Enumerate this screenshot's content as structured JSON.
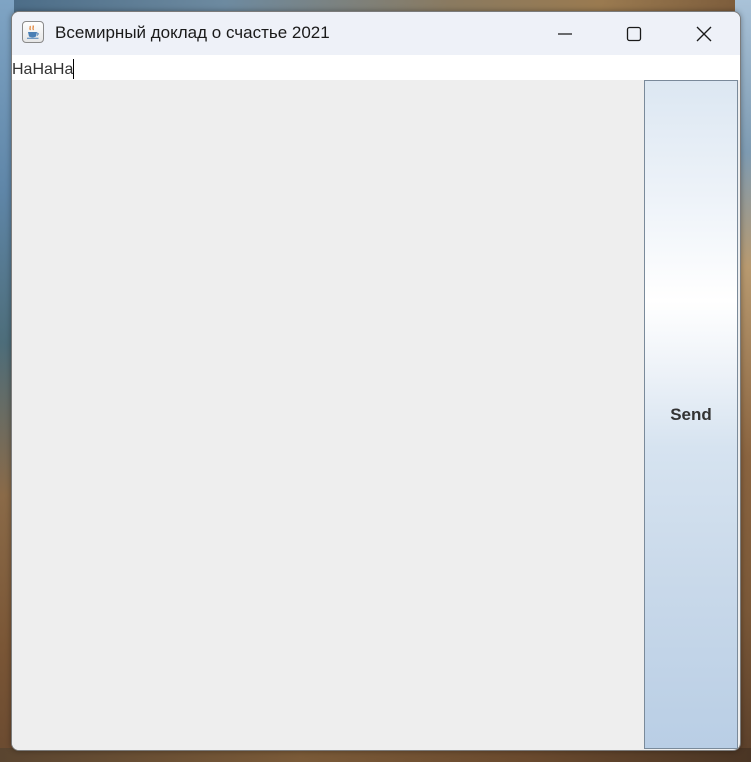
{
  "window": {
    "title": "Всемирный доклад о счастье 2021",
    "app_icon": "java-cup-icon"
  },
  "title_bar_controls": {
    "minimize_icon": "minimize-icon",
    "maximize_icon": "maximize-icon",
    "close_icon": "close-icon"
  },
  "input": {
    "value": "HaHaHa"
  },
  "output_area": {
    "value": ""
  },
  "send_button": {
    "label": "Send"
  }
}
